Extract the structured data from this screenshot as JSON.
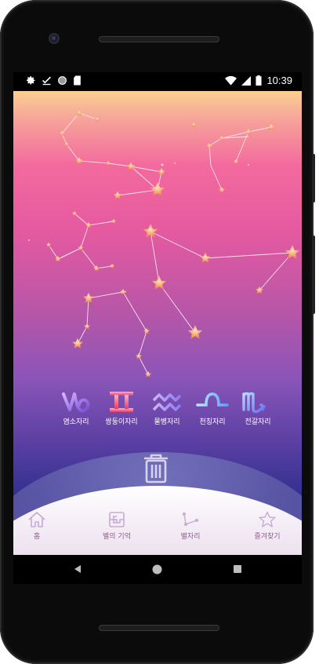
{
  "statusbar": {
    "time": "10:39",
    "left_icons": [
      "gear-icon",
      "check-icon",
      "circle-icon",
      "sd-card-icon"
    ],
    "right_icons": [
      "wifi-icon",
      "signal-icon",
      "battery-icon"
    ]
  },
  "zodiac_signs": [
    {
      "label": "염소자리",
      "symbol": "capricorn-icon"
    },
    {
      "label": "쌍둥이자리",
      "symbol": "gemini-icon"
    },
    {
      "label": "물병자리",
      "symbol": "aquarius-icon"
    },
    {
      "label": "천칭자리",
      "symbol": "libra-icon"
    },
    {
      "label": "전갈자리",
      "symbol": "scorpio-icon"
    }
  ],
  "bottom_nav": [
    {
      "label": "홈",
      "icon": "home-icon"
    },
    {
      "label": "별의 기억",
      "icon": "memory-icon"
    },
    {
      "label": "별자리",
      "icon": "constellation-icon"
    },
    {
      "label": "즐겨찾기",
      "icon": "star-outline-icon"
    }
  ],
  "colors": {
    "gradient_top": "#fcd08f",
    "gradient_mid": "#e55aa0",
    "gradient_bottom": "#2a2f86",
    "nav_label": "#8d5a8a",
    "star": "#f6a46a"
  }
}
